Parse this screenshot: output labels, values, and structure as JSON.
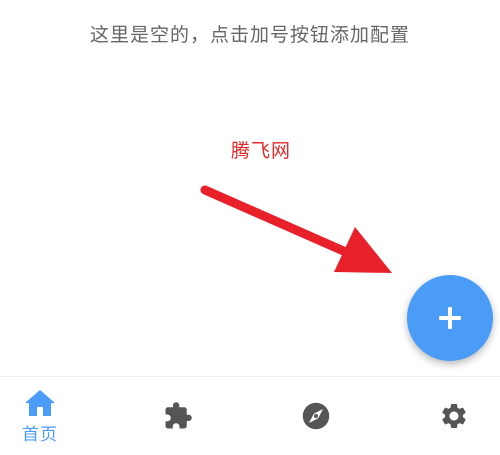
{
  "main": {
    "empty_hint": "这里是空的，点击加号按钮添加配置",
    "watermark": "腾飞网"
  },
  "fab": {
    "icon": "plus-icon",
    "color": "#4a9cf6"
  },
  "annotation": {
    "arrow_color": "#e8202a"
  },
  "bottom_nav": {
    "active_color": "#4a9cf6",
    "inactive_color": "#555555",
    "items": [
      {
        "id": "home",
        "icon": "home-icon",
        "label": "首页",
        "active": true
      },
      {
        "id": "plugins",
        "icon": "puzzle-icon",
        "label": "",
        "active": false
      },
      {
        "id": "discover",
        "icon": "compass-icon",
        "label": "",
        "active": false
      },
      {
        "id": "settings",
        "icon": "gear-icon",
        "label": "",
        "active": false
      }
    ]
  }
}
